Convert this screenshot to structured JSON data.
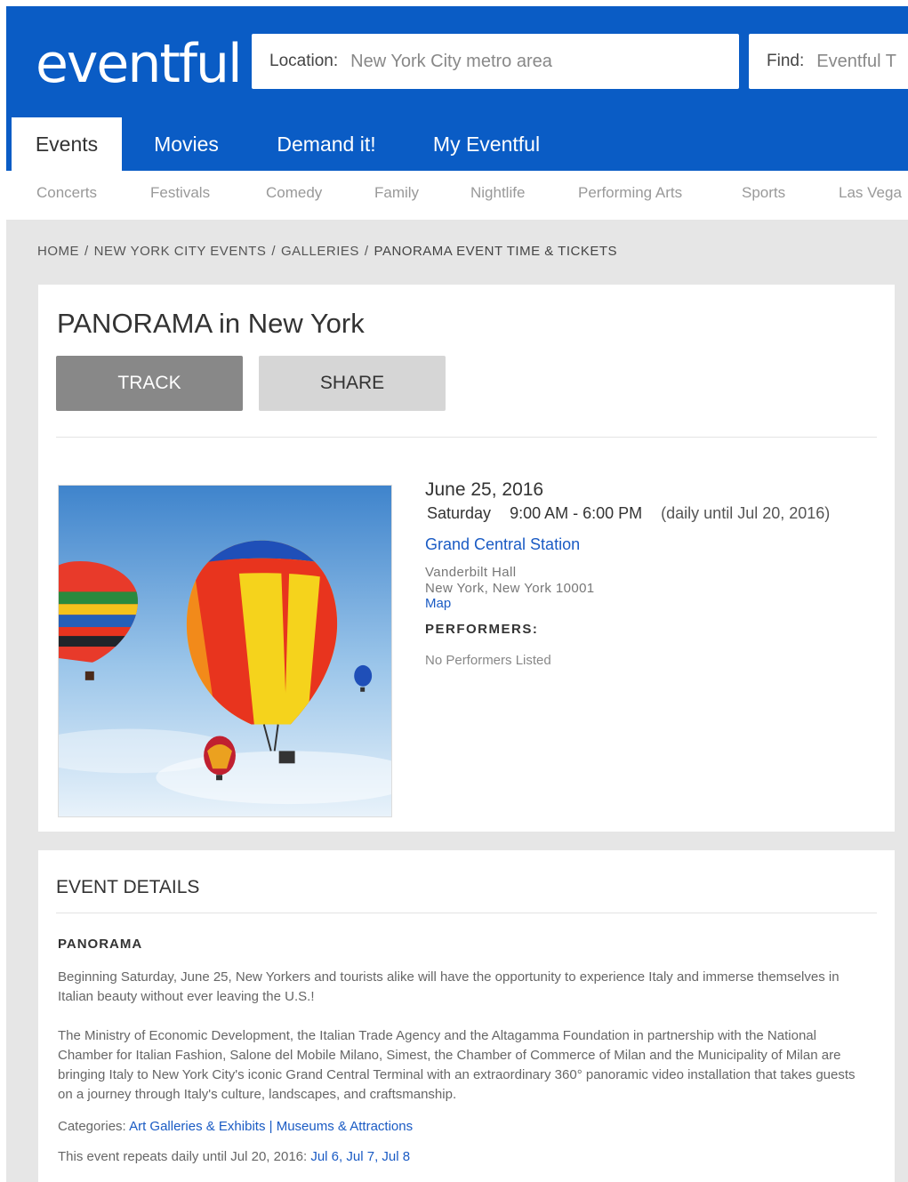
{
  "header": {
    "logo": "eventful",
    "location_label": "Location:",
    "location_value": "New York City metro area",
    "find_label": "Find:",
    "find_value": "Eventful T"
  },
  "main_nav": [
    "Events",
    "Movies",
    "Demand it!",
    "My Eventful"
  ],
  "sub_nav": [
    "Concerts",
    "Festivals",
    "Comedy",
    "Family",
    "Nightlife",
    "Performing Arts",
    "Sports",
    "Las Vega"
  ],
  "breadcrumb": {
    "items": [
      "HOME",
      "NEW YORK CITY EVENTS",
      "GALLERIES"
    ],
    "separator": "/",
    "current": "PANORAMA EVENT TIME & TICKETS"
  },
  "event": {
    "title": "PANORAMA in New York",
    "track_label": "TRACK",
    "share_label": "SHARE",
    "date": "June 25, 2016",
    "day": "Saturday",
    "time": "9:00 AM - 6:00 PM",
    "daily": "(daily until Jul 20, 2016)",
    "venue": "Grand Central Station",
    "address_line1": "Vanderbilt Hall",
    "address_line2": "New York, New York 10001",
    "map_label": "Map",
    "performers_label": "PERFORMERS:",
    "no_performers": "No Performers Listed"
  },
  "details": {
    "heading": "EVENT DETAILS",
    "name": "PANORAMA",
    "paragraph1": "Beginning Saturday, June 25, New Yorkers and tourists alike will have the opportunity to experience Italy and immerse themselves in Italian beauty without ever leaving the U.S.!",
    "paragraph2": "The Ministry of Economic Development, the Italian Trade Agency and the Altagamma Foundation in partnership with the National Chamber for Italian Fashion, Salone del Mobile Milano, Simest, the Chamber of Commerce of Milan and the Municipality of Milan are bringing Italy to New York City's iconic Grand Central Terminal with an extraordinary 360° panoramic video installation that takes guests on a journey through Italy's culture, landscapes, and craftsmanship.",
    "categories_label": "Categories:",
    "category1": "Art Galleries & Exhibits",
    "category_sep": "|",
    "category2": "Museums & Attractions",
    "repeats_text": "This event repeats daily until Jul 20, 2016:",
    "repeat_dates": [
      "Jul 6",
      "Jul 7",
      "Jul 8"
    ]
  }
}
